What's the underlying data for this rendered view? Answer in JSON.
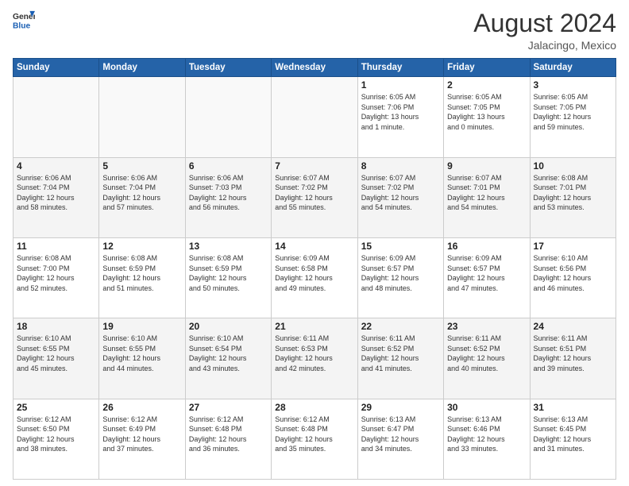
{
  "header": {
    "logo_line1": "General",
    "logo_line2": "Blue",
    "month": "August 2024",
    "location": "Jalacingo, Mexico"
  },
  "days_of_week": [
    "Sunday",
    "Monday",
    "Tuesday",
    "Wednesday",
    "Thursday",
    "Friday",
    "Saturday"
  ],
  "weeks": [
    [
      {
        "day": "",
        "info": ""
      },
      {
        "day": "",
        "info": ""
      },
      {
        "day": "",
        "info": ""
      },
      {
        "day": "",
        "info": ""
      },
      {
        "day": "1",
        "info": "Sunrise: 6:05 AM\nSunset: 7:06 PM\nDaylight: 13 hours\nand 1 minute."
      },
      {
        "day": "2",
        "info": "Sunrise: 6:05 AM\nSunset: 7:05 PM\nDaylight: 13 hours\nand 0 minutes."
      },
      {
        "day": "3",
        "info": "Sunrise: 6:05 AM\nSunset: 7:05 PM\nDaylight: 12 hours\nand 59 minutes."
      }
    ],
    [
      {
        "day": "4",
        "info": "Sunrise: 6:06 AM\nSunset: 7:04 PM\nDaylight: 12 hours\nand 58 minutes."
      },
      {
        "day": "5",
        "info": "Sunrise: 6:06 AM\nSunset: 7:04 PM\nDaylight: 12 hours\nand 57 minutes."
      },
      {
        "day": "6",
        "info": "Sunrise: 6:06 AM\nSunset: 7:03 PM\nDaylight: 12 hours\nand 56 minutes."
      },
      {
        "day": "7",
        "info": "Sunrise: 6:07 AM\nSunset: 7:02 PM\nDaylight: 12 hours\nand 55 minutes."
      },
      {
        "day": "8",
        "info": "Sunrise: 6:07 AM\nSunset: 7:02 PM\nDaylight: 12 hours\nand 54 minutes."
      },
      {
        "day": "9",
        "info": "Sunrise: 6:07 AM\nSunset: 7:01 PM\nDaylight: 12 hours\nand 54 minutes."
      },
      {
        "day": "10",
        "info": "Sunrise: 6:08 AM\nSunset: 7:01 PM\nDaylight: 12 hours\nand 53 minutes."
      }
    ],
    [
      {
        "day": "11",
        "info": "Sunrise: 6:08 AM\nSunset: 7:00 PM\nDaylight: 12 hours\nand 52 minutes."
      },
      {
        "day": "12",
        "info": "Sunrise: 6:08 AM\nSunset: 6:59 PM\nDaylight: 12 hours\nand 51 minutes."
      },
      {
        "day": "13",
        "info": "Sunrise: 6:08 AM\nSunset: 6:59 PM\nDaylight: 12 hours\nand 50 minutes."
      },
      {
        "day": "14",
        "info": "Sunrise: 6:09 AM\nSunset: 6:58 PM\nDaylight: 12 hours\nand 49 minutes."
      },
      {
        "day": "15",
        "info": "Sunrise: 6:09 AM\nSunset: 6:57 PM\nDaylight: 12 hours\nand 48 minutes."
      },
      {
        "day": "16",
        "info": "Sunrise: 6:09 AM\nSunset: 6:57 PM\nDaylight: 12 hours\nand 47 minutes."
      },
      {
        "day": "17",
        "info": "Sunrise: 6:10 AM\nSunset: 6:56 PM\nDaylight: 12 hours\nand 46 minutes."
      }
    ],
    [
      {
        "day": "18",
        "info": "Sunrise: 6:10 AM\nSunset: 6:55 PM\nDaylight: 12 hours\nand 45 minutes."
      },
      {
        "day": "19",
        "info": "Sunrise: 6:10 AM\nSunset: 6:55 PM\nDaylight: 12 hours\nand 44 minutes."
      },
      {
        "day": "20",
        "info": "Sunrise: 6:10 AM\nSunset: 6:54 PM\nDaylight: 12 hours\nand 43 minutes."
      },
      {
        "day": "21",
        "info": "Sunrise: 6:11 AM\nSunset: 6:53 PM\nDaylight: 12 hours\nand 42 minutes."
      },
      {
        "day": "22",
        "info": "Sunrise: 6:11 AM\nSunset: 6:52 PM\nDaylight: 12 hours\nand 41 minutes."
      },
      {
        "day": "23",
        "info": "Sunrise: 6:11 AM\nSunset: 6:52 PM\nDaylight: 12 hours\nand 40 minutes."
      },
      {
        "day": "24",
        "info": "Sunrise: 6:11 AM\nSunset: 6:51 PM\nDaylight: 12 hours\nand 39 minutes."
      }
    ],
    [
      {
        "day": "25",
        "info": "Sunrise: 6:12 AM\nSunset: 6:50 PM\nDaylight: 12 hours\nand 38 minutes."
      },
      {
        "day": "26",
        "info": "Sunrise: 6:12 AM\nSunset: 6:49 PM\nDaylight: 12 hours\nand 37 minutes."
      },
      {
        "day": "27",
        "info": "Sunrise: 6:12 AM\nSunset: 6:48 PM\nDaylight: 12 hours\nand 36 minutes."
      },
      {
        "day": "28",
        "info": "Sunrise: 6:12 AM\nSunset: 6:48 PM\nDaylight: 12 hours\nand 35 minutes."
      },
      {
        "day": "29",
        "info": "Sunrise: 6:13 AM\nSunset: 6:47 PM\nDaylight: 12 hours\nand 34 minutes."
      },
      {
        "day": "30",
        "info": "Sunrise: 6:13 AM\nSunset: 6:46 PM\nDaylight: 12 hours\nand 33 minutes."
      },
      {
        "day": "31",
        "info": "Sunrise: 6:13 AM\nSunset: 6:45 PM\nDaylight: 12 hours\nand 31 minutes."
      }
    ]
  ]
}
